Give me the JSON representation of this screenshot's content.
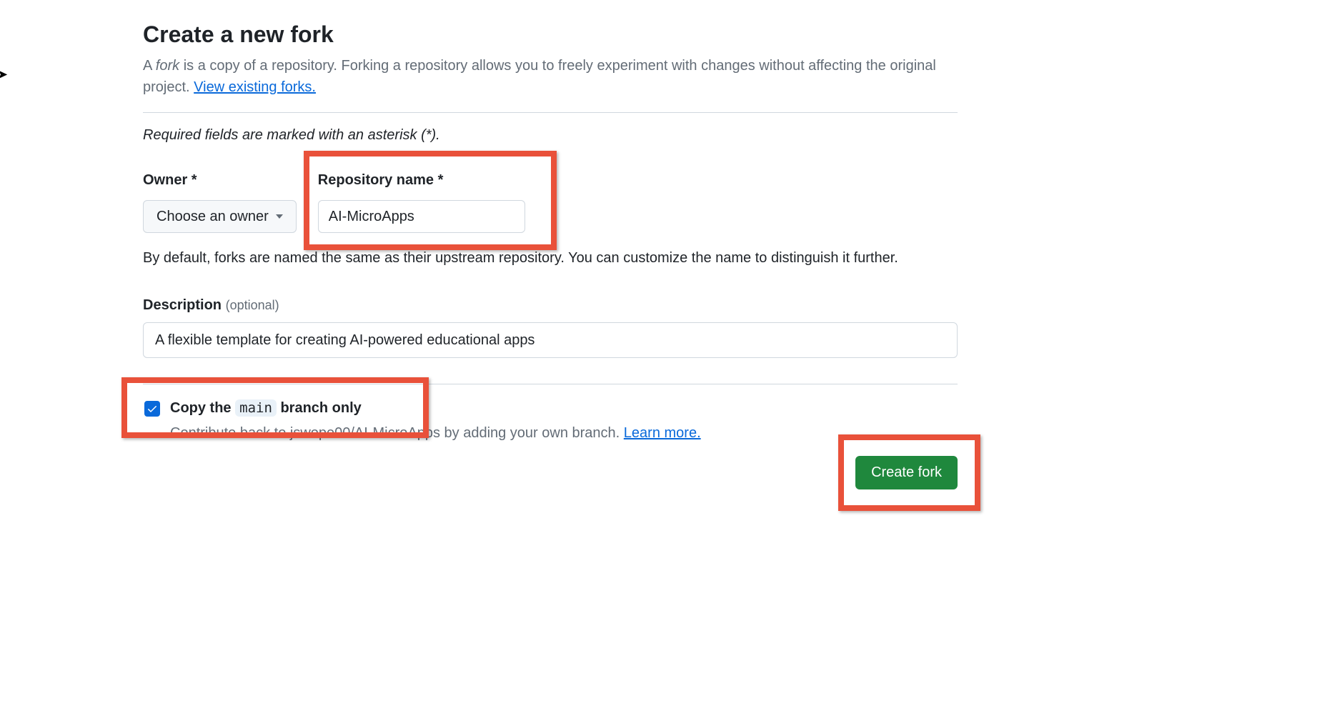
{
  "header": {
    "title": "Create a new fork",
    "intro_prefix": "A ",
    "intro_em": "fork",
    "intro_rest": " is a copy of a repository. Forking a repository allows you to freely experiment with changes without affecting the original project. ",
    "view_forks_link": "View existing forks."
  },
  "required_note": "Required fields are marked with an asterisk (*).",
  "owner": {
    "label": "Owner *",
    "button": "Choose an owner"
  },
  "repo": {
    "label": "Repository name *",
    "value": "AI-MicroApps"
  },
  "name_help": "By default, forks are named the same as their upstream repository. You can customize the name to distinguish it further.",
  "description": {
    "label": "Description",
    "optional": "(optional)",
    "value": "A flexible template for creating AI-powered educational apps"
  },
  "copy_branch": {
    "prefix": "Copy the ",
    "branch": "main",
    "suffix": " branch only",
    "help_prefix": "Contribute back to jswope00/AI-MicroApps by adding your own branch. ",
    "learn_more": "Learn more."
  },
  "submit": "Create fork"
}
